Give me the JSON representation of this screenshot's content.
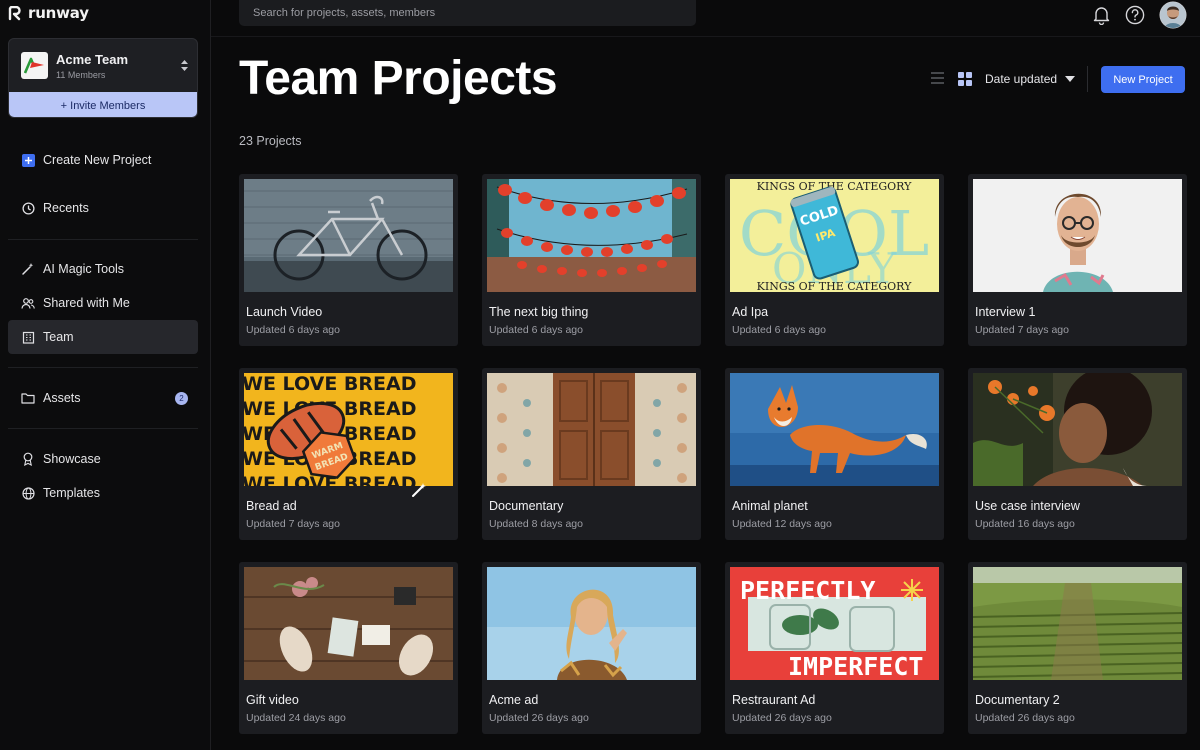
{
  "app": {
    "name": "runway"
  },
  "team": {
    "name": "Acme Team",
    "members": "11 Members",
    "invite_label": "+ Invite Members"
  },
  "nav": {
    "create": "Create New Project",
    "recents": "Recents",
    "magic": "AI Magic Tools",
    "shared": "Shared with Me",
    "team": "Team",
    "assets": "Assets",
    "assets_badge": "2",
    "showcase": "Showcase",
    "templates": "Templates"
  },
  "search": {
    "placeholder": "Search for projects, assets, members"
  },
  "header": {
    "title": "Team Projects",
    "sort_label": "Date updated",
    "new_project_label": "New Project",
    "count": "23 Projects"
  },
  "colors": {
    "accent": "#3e6ef0",
    "invite": "#b9c6f7",
    "card": "#1c1d21"
  },
  "projects": [
    {
      "name": "Launch Video",
      "updated": "Updated 6 days ago"
    },
    {
      "name": "The next big thing",
      "updated": "Updated 6 days ago"
    },
    {
      "name": "Ad Ipa",
      "updated": "Updated 6 days ago"
    },
    {
      "name": "Interview 1",
      "updated": "Updated 7 days ago"
    },
    {
      "name": "Bread ad",
      "updated": "Updated 7 days ago"
    },
    {
      "name": "Documentary",
      "updated": "Updated 8 days ago"
    },
    {
      "name": "Animal planet",
      "updated": "Updated 12 days ago"
    },
    {
      "name": "Use case interview",
      "updated": "Updated 16 days ago"
    },
    {
      "name": "Gift video",
      "updated": "Updated 24 days ago"
    },
    {
      "name": "Acme ad",
      "updated": "Updated 26 days ago"
    },
    {
      "name": "Restraurant Ad",
      "updated": "Updated 26 days ago"
    },
    {
      "name": "Documentary 2",
      "updated": "Updated 26 days ago"
    }
  ],
  "thumb_text": {
    "ad_ipa_banner": "KINGS OF THE CATEGORY",
    "ad_ipa_can_top": "COLD",
    "ad_ipa_can_bottom": "IPA",
    "bread_line": "WE LOVE BREAD",
    "bread_badge_top": "WARM",
    "bread_badge_bottom": "BREAD",
    "restaurant_top": "PERFECTLY",
    "restaurant_bottom": "IMPERFECT"
  }
}
